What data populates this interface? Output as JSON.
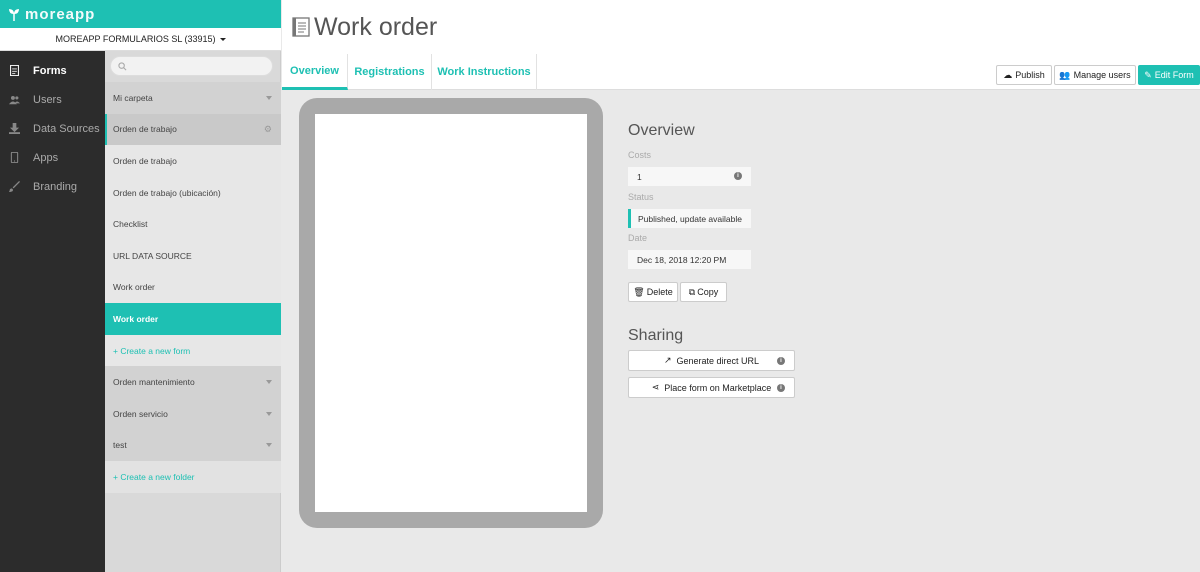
{
  "app": {
    "logo_text": "moreapp",
    "org_label": "MOREAPP FORMULARIOS SL (33915)"
  },
  "nav": {
    "items": [
      {
        "label": "Forms",
        "icon": "document-icon",
        "active": true
      },
      {
        "label": "Users",
        "icon": "users-icon",
        "active": false
      },
      {
        "label": "Data Sources",
        "icon": "download-icon",
        "active": false
      },
      {
        "label": "Apps",
        "icon": "mobile-icon",
        "active": false
      },
      {
        "label": "Branding",
        "icon": "brush-icon",
        "active": false
      }
    ]
  },
  "folders": {
    "search_placeholder": "",
    "rows": [
      {
        "label": "Mi carpeta",
        "kind": "folder"
      },
      {
        "label": "Orden de trabajo",
        "kind": "folder-open"
      },
      {
        "label": "Orden de trabajo",
        "kind": "form"
      },
      {
        "label": "Orden de trabajo (ubicación)",
        "kind": "form"
      },
      {
        "label": "Checklist",
        "kind": "form"
      },
      {
        "label": "URL DATA SOURCE",
        "kind": "form"
      },
      {
        "label": "Work order",
        "kind": "form"
      },
      {
        "label": "Work order",
        "kind": "form-selected"
      },
      {
        "label": "+ Create a new form",
        "kind": "create"
      },
      {
        "label": "Orden mantenimiento",
        "kind": "folder"
      },
      {
        "label": "Orden servicio",
        "kind": "folder"
      },
      {
        "label": "test",
        "kind": "folder"
      },
      {
        "label": "+ Create a new folder",
        "kind": "create-folder"
      }
    ]
  },
  "page": {
    "title": "Work order",
    "tabs": [
      "Overview",
      "Registrations",
      "Work Instructions"
    ]
  },
  "toolbar": {
    "publish": "Publish",
    "manage_users": "Manage users",
    "edit_form": "Edit Form"
  },
  "overview": {
    "title": "Overview",
    "costs_label": "Costs",
    "costs_value": "1",
    "status_label": "Status",
    "status_value": "Published, update available",
    "date_label": "Date",
    "date_value": "Dec 18, 2018 12:20 PM",
    "delete": "Delete",
    "copy": "Copy"
  },
  "sharing": {
    "title": "Sharing",
    "direct_url": "Generate direct URL",
    "marketplace": "Place form on Marketplace"
  },
  "colors": {
    "accent": "#1ec0b3",
    "nav_bg": "#2c2c2c"
  }
}
